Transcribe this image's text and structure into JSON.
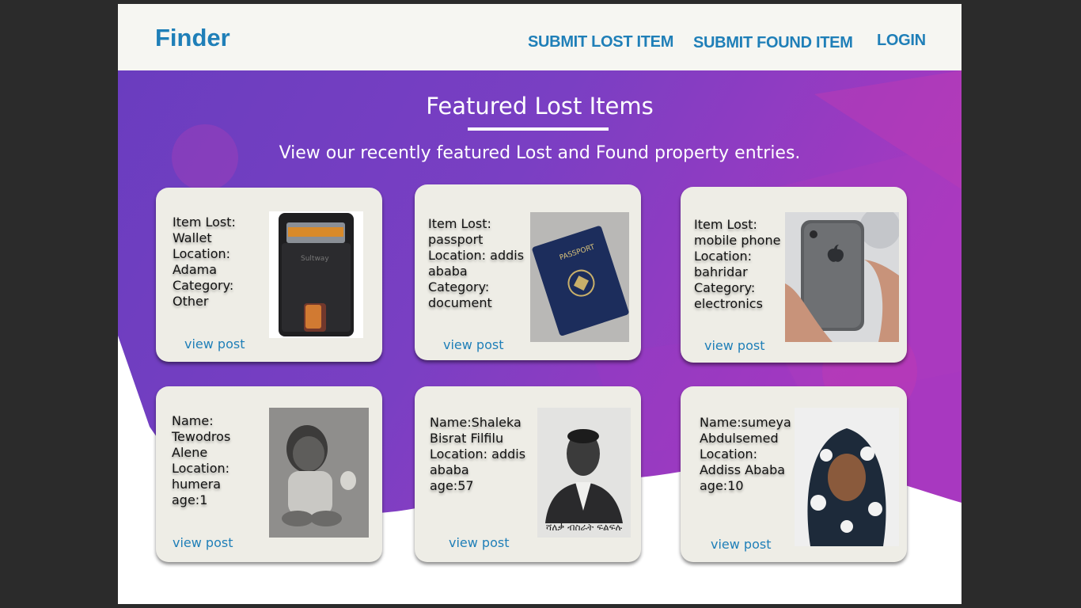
{
  "header": {
    "brand": "Finder",
    "nav": {
      "submit_lost": "SUBMIT LOST ITEM",
      "submit_found": "SUBMIT FOUND ITEM",
      "login": "LOGIN"
    }
  },
  "hero": {
    "title": "Featured Lost Items",
    "subtitle": "View our recently featured Lost and Found property entries."
  },
  "cards": [
    {
      "text": "Item Lost:\nWallet\nLocation:\nAdama\nCategory:\nOther",
      "link": "view post",
      "image": "wallet-photo"
    },
    {
      "text": "Item Lost:\npassport\nLocation: addis\nababa\nCategory:\ndocument",
      "link": "view post",
      "image": "passport-photo"
    },
    {
      "text": "Item Lost:\nmobile phone\nLocation:\nbahridar\nCategory:\nelectronics",
      "link": "view post",
      "image": "phone-photo"
    },
    {
      "text": "Name:\nTewodros\nAlene\nLocation:\nhumera\nage:1",
      "link": "view post",
      "image": "baby-photo"
    },
    {
      "text": "Name:Shaleka\nBisrat Filfilu\nLocation: addis\nababa\nage:57",
      "link": "view post",
      "image": "man-portrait-photo",
      "caption": "ሻለቃ ብስራት ፍልፍሉ"
    },
    {
      "text": "Name:sumeya\nAbdulsemed\nLocation:\nAddiss Ababa\nage:10",
      "link": "view post",
      "image": "girl-portrait-photo"
    }
  ],
  "colors": {
    "brand": "#1f7fb8",
    "hero_purple": "#7b3fbf",
    "card_bg": "#eeede6"
  }
}
